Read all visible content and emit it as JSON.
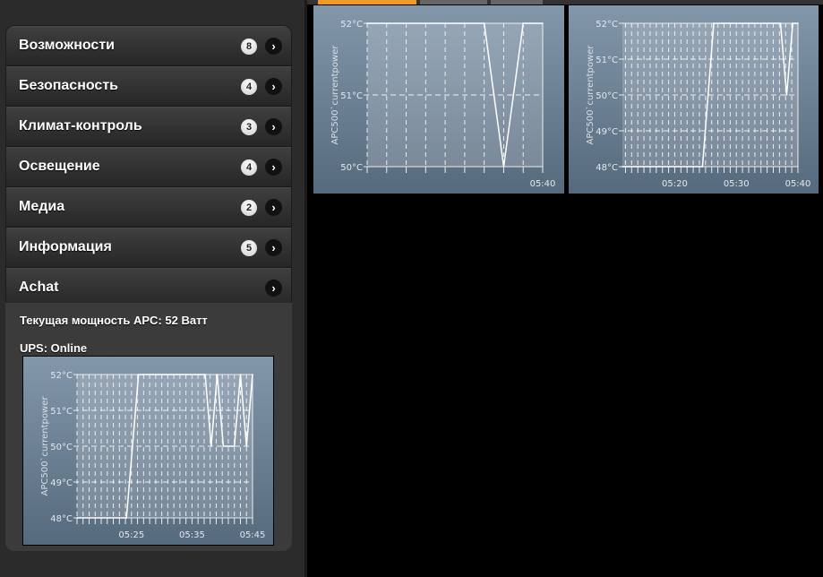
{
  "menu": [
    {
      "label": "Возможности",
      "badge": "8"
    },
    {
      "label": "Безопасность",
      "badge": "4"
    },
    {
      "label": "Климат-контроль",
      "badge": "3"
    },
    {
      "label": "Освещение",
      "badge": "4"
    },
    {
      "label": "Медиа",
      "badge": "2"
    },
    {
      "label": "Информация",
      "badge": "5"
    },
    {
      "label": "Achat",
      "badge": null
    }
  ],
  "info": {
    "power": "Текущая мощность APC: 52 Ватт",
    "ups": "UPS: Online"
  },
  "colors": {
    "tab_active": "#f39a25",
    "tab_inactive": "#666666"
  },
  "chart_data": [
    {
      "type": "line",
      "ylabel": "APC500`currentpower",
      "ylim": [
        50,
        52
      ],
      "yticks": [
        "50°C",
        "51°C",
        "52°C"
      ],
      "yvals": [
        50,
        51,
        52
      ],
      "xlim": [
        "05:31",
        "05:40"
      ],
      "xticklabels": [
        "05:40"
      ],
      "points": [
        [
          "05:31",
          52
        ],
        [
          "05:37",
          52
        ],
        [
          "05:38",
          50
        ],
        [
          "05:39",
          52
        ],
        [
          "05:40",
          52
        ]
      ]
    },
    {
      "type": "line",
      "ylabel": "APC500`currentpower",
      "ylim": [
        48,
        52
      ],
      "yticks": [
        "48°C",
        "49°C",
        "50°C",
        "51°C",
        "52°C"
      ],
      "yvals": [
        48,
        49,
        50,
        51,
        52
      ],
      "xlim": [
        "05:11:30",
        "05:40"
      ],
      "xticklabels": [
        "05:20",
        "05:30",
        "05:40"
      ],
      "points": [
        [
          "05:11:30",
          48
        ],
        [
          "05:24:30",
          48
        ],
        [
          "05:26:20",
          52
        ],
        [
          "05:37:10",
          52
        ],
        [
          "05:38:10",
          50
        ],
        [
          "05:39:10",
          52
        ],
        [
          "05:40",
          52
        ]
      ]
    },
    {
      "type": "line",
      "ylabel": "APC500`currentpower",
      "ylim": [
        48,
        52
      ],
      "yticks": [
        "48°C",
        "49°C",
        "50°C",
        "51°C",
        "52°C"
      ],
      "yvals": [
        48,
        49,
        50,
        51,
        52
      ],
      "xlim": [
        "05:16",
        "05:45"
      ],
      "xticklabels": [
        "05:25",
        "05:35",
        "05:45"
      ],
      "points": [
        [
          "05:16",
          48
        ],
        [
          "05:24:10",
          48
        ],
        [
          "05:26:10",
          52
        ],
        [
          "05:37:10",
          52
        ],
        [
          "05:38:10",
          50
        ],
        [
          "05:39:10",
          52
        ],
        [
          "05:40:10",
          50
        ],
        [
          "05:42",
          50
        ],
        [
          "05:43",
          52
        ],
        [
          "05:44",
          50
        ],
        [
          "05:45",
          52
        ]
      ]
    }
  ]
}
